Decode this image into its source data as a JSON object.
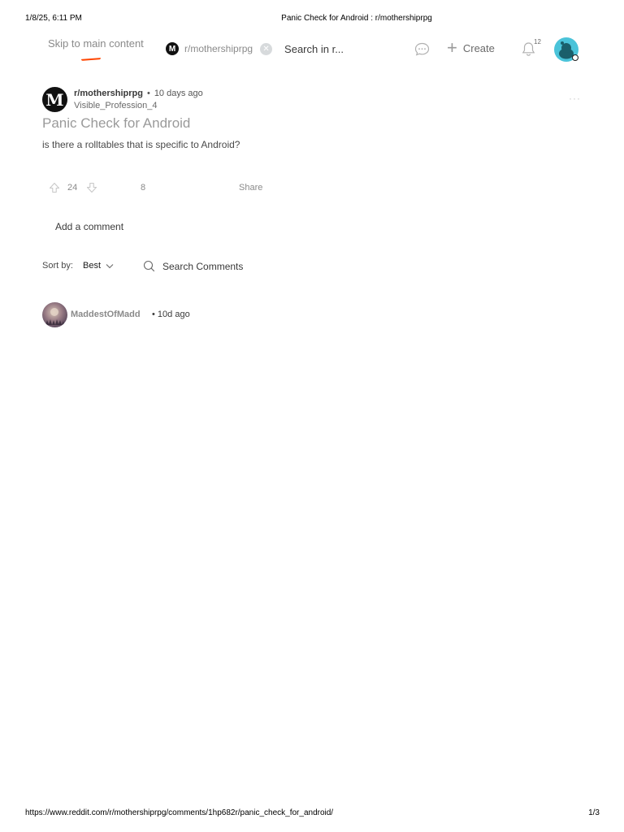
{
  "print": {
    "date": "1/8/25, 6:11 PM",
    "title": "Panic Check for Android : r/mothershiprpg",
    "url": "https://www.reddit.com/r/mothershiprpg/comments/1hp682r/panic_check_for_android/",
    "page": "1/3"
  },
  "nav": {
    "skip_link": "Skip to main content",
    "subreddit_chip": "r/mothershiprpg",
    "subreddit_chip_icon_letter": "M",
    "search_placeholder": "Search in r...",
    "create_label": "Create",
    "notification_count": "12",
    "icons": [
      "chat-icon",
      "plus-icon",
      "bell-icon",
      "clear-icon"
    ],
    "accent_color": "#ff4500"
  },
  "post": {
    "avatar_letter": "M",
    "subreddit": "r/mothershiprpg",
    "separator": "•",
    "time": "10 days ago",
    "author": "Visible_Profession_4",
    "more": "···",
    "title": "Panic Check for Android",
    "body": "is there a rolltables that is specific to Android?",
    "votes": "24",
    "comments": "8",
    "share": "Share"
  },
  "comment_box": {
    "placeholder": "Add a comment"
  },
  "sort": {
    "label": "Sort by:",
    "value": "Best",
    "search_comments": "Search Comments"
  },
  "comments": [
    {
      "author": "MaddestOfMadd",
      "separator": "•",
      "time": "10d ago"
    }
  ]
}
